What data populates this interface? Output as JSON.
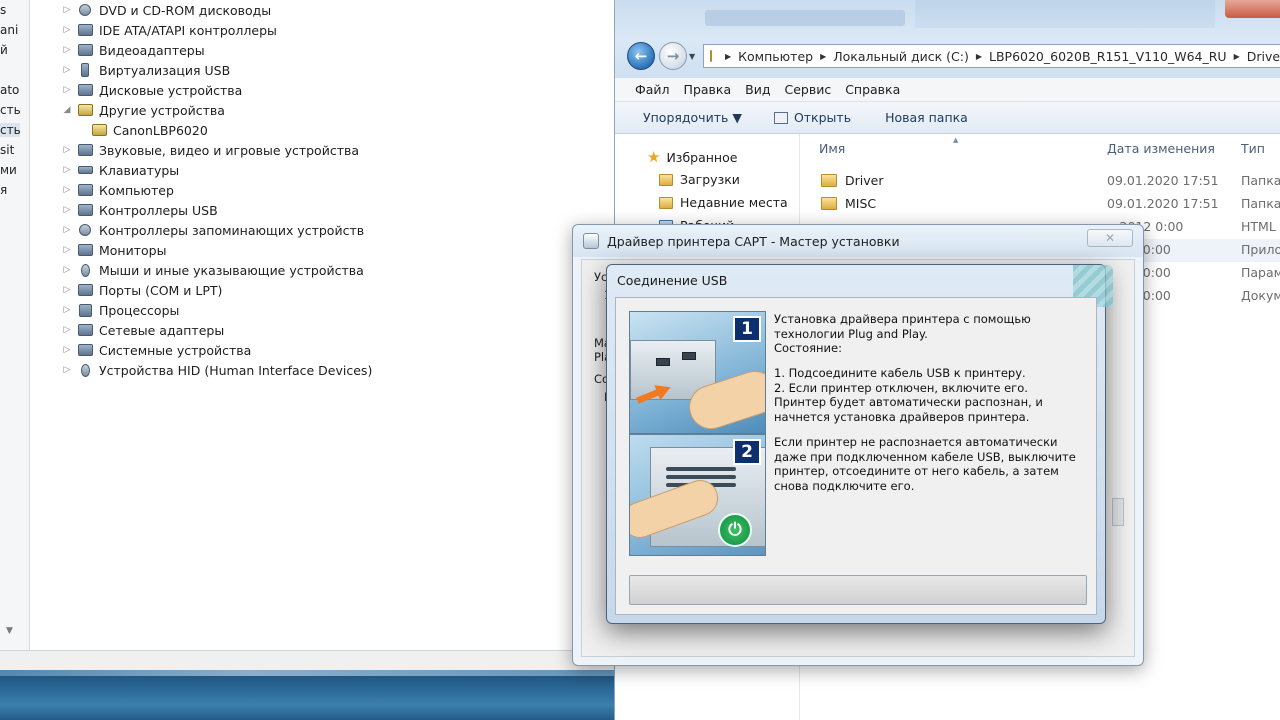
{
  "device_manager": {
    "left_fragments": [
      "s",
      "ani",
      "й",
      "",
      "ato",
      "сть",
      "сть",
      "sit",
      "ми",
      "я"
    ],
    "tree": [
      {
        "label": "DVD и CD-ROM дисководы",
        "expanded": false,
        "icon": "disc-drive-icon"
      },
      {
        "label": "IDE ATA/ATAPI контроллеры",
        "expanded": false,
        "icon": "ide-controller-icon"
      },
      {
        "label": "Видеоадаптеры",
        "expanded": false,
        "icon": "display-adapter-icon"
      },
      {
        "label": "Виртуализация USB",
        "expanded": false,
        "icon": "usb-virtualization-icon"
      },
      {
        "label": "Дисковые устройства",
        "expanded": false,
        "icon": "disk-drive-icon"
      },
      {
        "label": "Другие устройства",
        "expanded": true,
        "icon": "other-devices-icon"
      },
      {
        "label": "CanonLBP6020",
        "child": true,
        "icon": "unknown-device-warning-icon"
      },
      {
        "label": "Звуковые, видео и игровые устройства",
        "expanded": false,
        "icon": "sound-icon"
      },
      {
        "label": "Клавиатуры",
        "expanded": false,
        "icon": "keyboard-icon"
      },
      {
        "label": "Компьютер",
        "expanded": false,
        "icon": "computer-icon"
      },
      {
        "label": "Контроллеры USB",
        "expanded": false,
        "icon": "usb-controller-icon"
      },
      {
        "label": "Контроллеры запоминающих устройств",
        "expanded": false,
        "icon": "storage-controller-icon"
      },
      {
        "label": "Мониторы",
        "expanded": false,
        "icon": "monitor-icon"
      },
      {
        "label": "Мыши и иные указывающие устройства",
        "expanded": false,
        "icon": "mouse-icon"
      },
      {
        "label": "Порты (COM и LPT)",
        "expanded": false,
        "icon": "port-icon"
      },
      {
        "label": "Процессоры",
        "expanded": false,
        "icon": "processor-icon"
      },
      {
        "label": "Сетевые адаптеры",
        "expanded": false,
        "icon": "network-adapter-icon"
      },
      {
        "label": "Системные устройства",
        "expanded": false,
        "icon": "system-device-icon"
      },
      {
        "label": "Устройства HID (Human Interface Devices)",
        "expanded": false,
        "icon": "hid-icon"
      }
    ]
  },
  "explorer": {
    "breadcrumb": [
      "Компьютер",
      "Локальный диск (C:)",
      "LBP6020_6020B_R151_V110_W64_RU",
      "Drivers"
    ],
    "menu": [
      "Файл",
      "Правка",
      "Вид",
      "Сервис",
      "Справка"
    ],
    "commands": {
      "organize": "Упорядочить ▼",
      "open": "Открыть",
      "new_folder": "Новая папка"
    },
    "nav": {
      "favorites": "Избранное",
      "downloads": "Загрузки",
      "recent": "Недавние места",
      "desktop": "Рабочий"
    },
    "columns": {
      "name": "Имя",
      "date": "Дата изменения",
      "type": "Тип"
    },
    "files": [
      {
        "name": "Driver",
        "date": "09.01.2020 17:51",
        "type": "Папка"
      },
      {
        "name": "MISC",
        "date": "09.01.2020 17:51",
        "type": "Папка"
      },
      {
        "name": "",
        "date": "…2012 0:00",
        "type": "HTML"
      },
      {
        "name": "",
        "date": "2012 0:00",
        "type": "Прило"
      },
      {
        "name": "",
        "date": "2012 0:00",
        "type": "Парам"
      },
      {
        "name": "",
        "date": "2012 0:00",
        "type": "Докум"
      }
    ]
  },
  "wizard": {
    "title": "Драйвер принтера CAPT - Мастер установки",
    "close_glyph": "✕",
    "fragments": [
      "Уст",
      "1",
      "Ма",
      "Pla",
      "Со",
      "F"
    ]
  },
  "usb_dialog": {
    "title": "Соединение USB",
    "step1_number": "1",
    "step2_number": "2",
    "intro": "Установка драйвера принтера с помощью технологии Plug and Play.",
    "status_label": "Состояние:",
    "step1": "1. Подсоедините кабель USB к принтеру.",
    "step2": "2. Если принтер отключен, включите его.",
    "auto_detect": "Принтер будет автоматически распознан, и начнется установка драйверов принтера.",
    "not_detected": "Если принтер не распознается автоматически даже при подключенном кабеле USB, выключите принтер, отсоедините от него кабель, а затем снова подключите его.",
    "progress": 0
  }
}
